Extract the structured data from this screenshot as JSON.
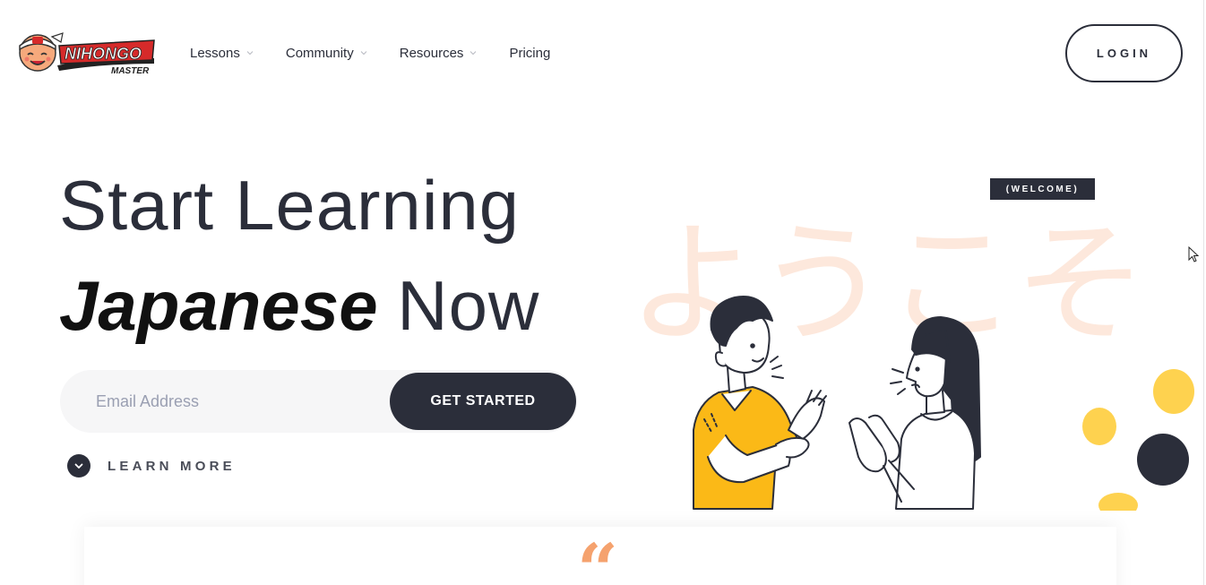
{
  "header": {
    "logo": {
      "text": "NIHONGO",
      "subtext": "MASTER"
    },
    "nav": [
      {
        "label": "Lessons",
        "has_dropdown": true
      },
      {
        "label": "Community",
        "has_dropdown": true
      },
      {
        "label": "Resources",
        "has_dropdown": true
      },
      {
        "label": "Pricing",
        "has_dropdown": false
      }
    ],
    "login_label": "LOGIN"
  },
  "hero": {
    "line1": "Start Learning",
    "line2_bold": "Japanese",
    "line2_light": "Now",
    "email_placeholder": "Email Address",
    "cta_label": "GET STARTED",
    "learn_more_label": "LEARN MORE"
  },
  "illustration": {
    "welcome_badge": "(WELCOME)",
    "kana": "ようこそ"
  },
  "quote": {
    "mark": "“"
  },
  "colors": {
    "dark": "#2b2e3a",
    "input_bg": "#f6f6f7",
    "kana_peach": "#fde8dc",
    "shirt_yellow": "#fbb917",
    "blob_yellow": "#fed24f",
    "quote_orange": "#f5a26e"
  }
}
